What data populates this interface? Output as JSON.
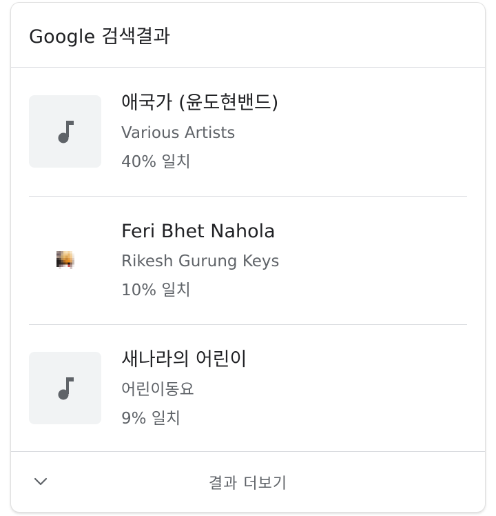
{
  "header": {
    "title": "Google 검색결과"
  },
  "results": [
    {
      "title": "애국가 (윤도현밴드)",
      "artist": "Various Artists",
      "match": "40% 일치",
      "thumbnail": "music-note-icon"
    },
    {
      "title": "Feri Bhet Nahola",
      "artist": "Rikesh Gurung Keys",
      "match": "10% 일치",
      "thumbnail": "album-art-image"
    },
    {
      "title": "새나라의 어린이",
      "artist": "어린이동요",
      "match": "9% 일치",
      "thumbnail": "music-note-icon"
    }
  ],
  "footer": {
    "more_label": "결과 더보기",
    "icon": "chevron-down-icon"
  },
  "colors": {
    "text_primary": "#202124",
    "text_secondary": "#5f6368",
    "divider": "#dadce0",
    "thumb_bg": "#f1f3f4"
  }
}
